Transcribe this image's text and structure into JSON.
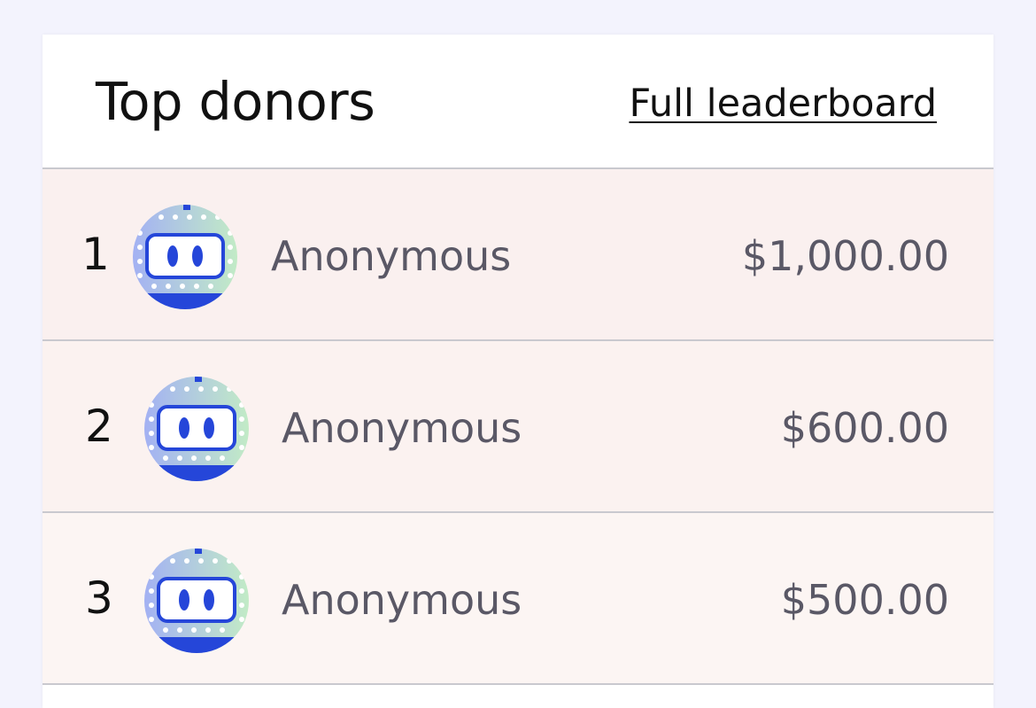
{
  "header": {
    "title": "Top donors",
    "link_label": "Full leaderboard"
  },
  "donors": [
    {
      "rank": "1",
      "name": "Anonymous",
      "amount": "$1,000.00",
      "avatar_icon": "robot-face-icon"
    },
    {
      "rank": "2",
      "name": "Anonymous",
      "amount": "$600.00",
      "avatar_icon": "robot-face-icon"
    },
    {
      "rank": "3",
      "name": "Anonymous",
      "amount": "$500.00",
      "avatar_icon": "robot-face-icon"
    }
  ],
  "colors": {
    "page_background": "#f3f3fd",
    "row_1_background": "#faf0ef",
    "row_2_background": "#fbf2f0",
    "row_3_background": "#fcf5f3",
    "avatar_blue": "#2546d9",
    "avatar_gradient_start": "#a9b8f2",
    "avatar_gradient_end": "#bfe8c8"
  }
}
